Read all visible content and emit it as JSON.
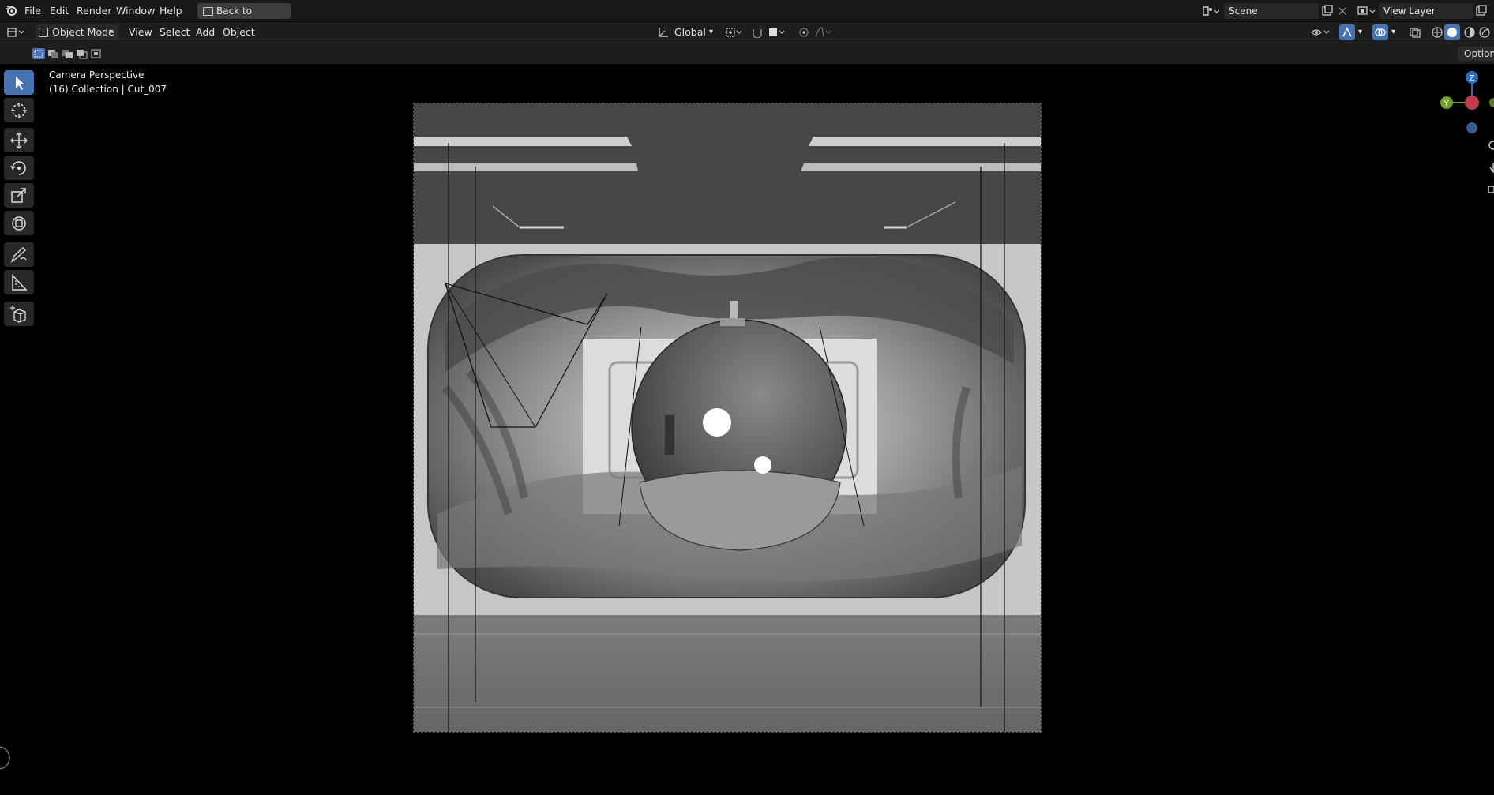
{
  "topbar": {
    "menus": [
      "File",
      "Edit",
      "Render",
      "Window",
      "Help"
    ],
    "back_button": "Back to Previous",
    "scene": "Scene",
    "view_layer": "View Layer"
  },
  "header": {
    "mode": "Object Mode",
    "menus": [
      "View",
      "Select",
      "Add",
      "Object"
    ],
    "transform_orientation": "Global",
    "options": "Options"
  },
  "viewport": {
    "title": "Camera Perspective",
    "subtitle": "(16) Collection | Cut_007"
  },
  "gizmo": {
    "z": "Z",
    "y": "Y"
  },
  "colors": {
    "accent": "#4772b3",
    "axis_z": "#2d6cc0",
    "axis_y": "#6f9e2a",
    "axis_x": "#c13c4c"
  }
}
